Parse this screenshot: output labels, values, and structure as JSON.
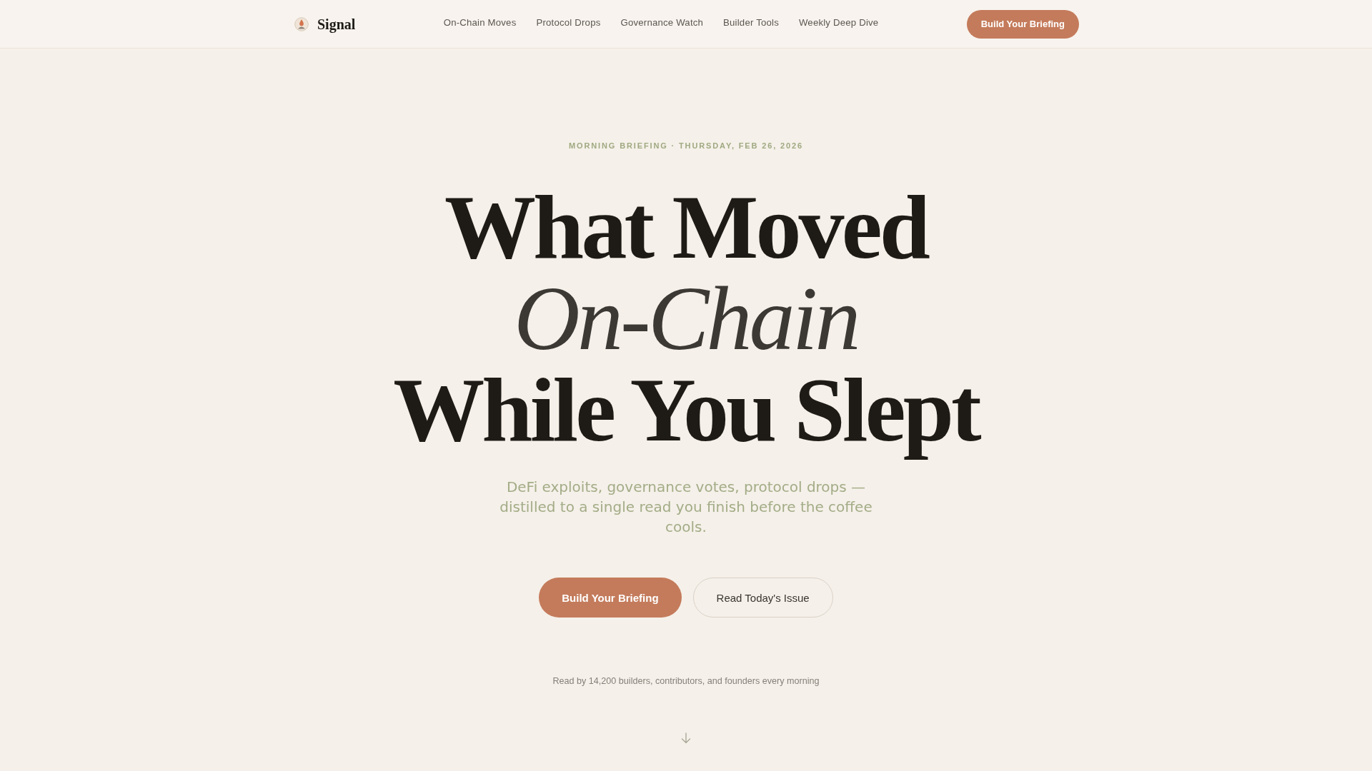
{
  "nav": {
    "brand": "Signal",
    "links": [
      {
        "label": "On-Chain Moves"
      },
      {
        "label": "Protocol Drops"
      },
      {
        "label": "Governance Watch"
      },
      {
        "label": "Builder Tools"
      },
      {
        "label": "Weekly Deep Dive"
      }
    ],
    "cta": "Build Your Briefing"
  },
  "hero": {
    "eyebrow": "MORNING BRIEFING · THURSDAY, FEB 26, 2026",
    "headline": [
      {
        "text": "What Moved",
        "kind": "bold"
      },
      {
        "text": "On-Chain",
        "kind": "italic"
      },
      {
        "text": "While You Slept",
        "kind": "bold"
      }
    ],
    "subtitle": "DeFi exploits, governance votes, protocol drops — distilled to a single read you finish before the coffee cools.",
    "buttons": [
      {
        "label": "Build Your Briefing",
        "kind": "primary"
      },
      {
        "label": "Read Today's Issue",
        "kind": "secondary"
      }
    ],
    "social_proof": "Read by 14,200 builders, contributors, and founders every morning"
  }
}
